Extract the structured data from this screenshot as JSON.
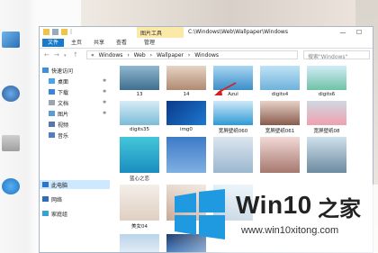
{
  "window": {
    "title_path": "C:\\Windows\\Web\\Wallpaper\\Windows",
    "context_tab": "图片工具",
    "qat_label": "|",
    "minimize": "—",
    "maximize": "☐"
  },
  "tabs": [
    "文件",
    "主页",
    "共享",
    "查看",
    "管理"
  ],
  "address": {
    "crumbs": [
      "«",
      "Windows",
      "›",
      "Web",
      "›",
      "Wallpaper",
      "›",
      "Windows"
    ],
    "search_placeholder": "搜索\"Windows\""
  },
  "sidebar": {
    "items": [
      {
        "label": "快速访问",
        "icon": "star-icon"
      },
      {
        "label": "桌面",
        "icon": "desktop-icon",
        "pinned": true
      },
      {
        "label": "下载",
        "icon": "download-icon",
        "pinned": true
      },
      {
        "label": "文档",
        "icon": "document-icon",
        "pinned": true
      },
      {
        "label": "图片",
        "icon": "picture-icon",
        "pinned": true
      },
      {
        "label": "视频",
        "icon": "video-icon"
      },
      {
        "label": "音乐",
        "icon": "music-icon"
      },
      {
        "label": "此电脑",
        "icon": "computer-icon",
        "selected": true
      },
      {
        "label": "网络",
        "icon": "network-icon"
      },
      {
        "label": "家庭组",
        "icon": "homegroup-icon"
      }
    ]
  },
  "files": [
    {
      "name": "13"
    },
    {
      "name": "14"
    },
    {
      "name": "Azul"
    },
    {
      "name": "digits4"
    },
    {
      "name": "digits6"
    },
    {
      "name": "digits35"
    },
    {
      "name": "img0"
    },
    {
      "name": "宽屏壁纸060"
    },
    {
      "name": "宽屏壁纸061"
    },
    {
      "name": "宽屏壁纸08"
    },
    {
      "name": "蓝心之恋"
    },
    {
      "name": ""
    },
    {
      "name": ""
    },
    {
      "name": ""
    },
    {
      "name": ""
    },
    {
      "name": "美女04"
    },
    {
      "name": ""
    },
    {
      "name": ""
    },
    {
      "name": ""
    },
    {
      "name": ""
    }
  ],
  "watermark": {
    "brand": "Win10",
    "brand_zh": "之家",
    "url": "www.win10xitong.com"
  },
  "colors": {
    "accent": "#1979ca",
    "context_tab": "#fbe9a8",
    "selection": "#cde8ff",
    "logo_blue": "#1f9ae0"
  }
}
